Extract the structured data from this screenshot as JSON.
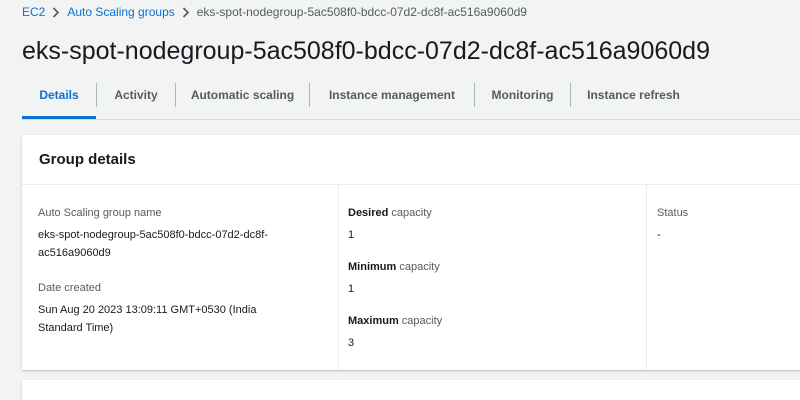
{
  "breadcrumb": {
    "items": [
      {
        "label": "EC2"
      },
      {
        "label": "Auto Scaling groups"
      }
    ],
    "current": "eks-spot-nodegroup-5ac508f0-bdcc-07d2-dc8f-ac516a9060d9"
  },
  "page": {
    "title": "eks-spot-nodegroup-5ac508f0-bdcc-07d2-dc8f-ac516a9060d9"
  },
  "tabs": [
    {
      "label": "Details",
      "active": true
    },
    {
      "label": "Activity"
    },
    {
      "label": "Automatic scaling"
    },
    {
      "label": "Instance management"
    },
    {
      "label": "Monitoring"
    },
    {
      "label": "Instance refresh"
    }
  ],
  "group_details": {
    "title": "Group details",
    "asg_name_label": "Auto Scaling group name",
    "asg_name_line1": "eks-spot-nodegroup-5ac508f0-bdcc-07d2-dc8f-",
    "asg_name_line2": "ac516a9060d9",
    "date_created_label": "Date created",
    "date_created_line1": "Sun Aug 20 2023 13:09:11 GMT+0530 (India",
    "date_created_line2": "Standard Time)",
    "desired": {
      "bold": "Desired",
      "rest": " capacity",
      "value": "1"
    },
    "minimum": {
      "bold": "Minimum",
      "rest": " capacity",
      "value": "1"
    },
    "maximum": {
      "bold": "Maximum",
      "rest": " capacity",
      "value": "3"
    },
    "status_label": "Status",
    "status_value": "-"
  },
  "colors": {
    "link": "#0972d3",
    "page_bg": "#f2f3f3",
    "text": "#16191f",
    "muted": "#545b64"
  }
}
